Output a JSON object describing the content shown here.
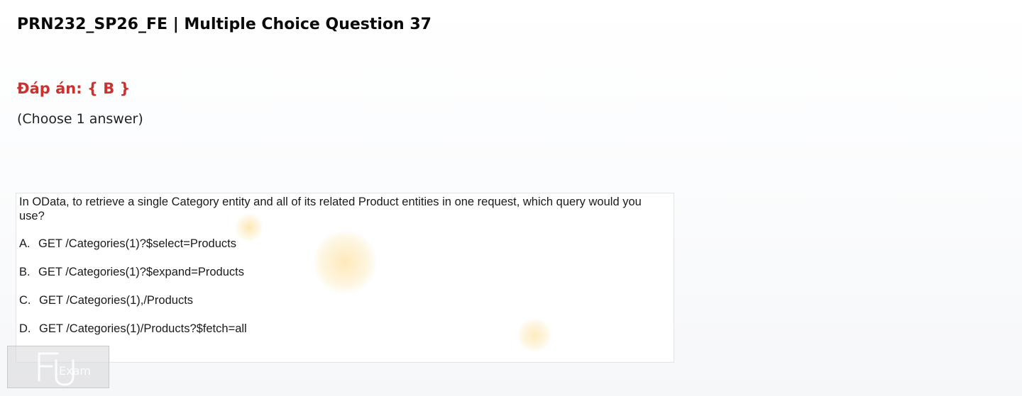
{
  "header": {
    "title": "PRN232_SP26_FE | Multiple Choice Question 37"
  },
  "answer": {
    "text": "Đáp án: { B }",
    "color": "#c8322f"
  },
  "instruction": {
    "text": "(Choose 1 answer)"
  },
  "question": {
    "text": "In OData, to retrieve a single Category entity and all of its related Product entities in one request, which query would you use?",
    "options": [
      {
        "letter": "A.",
        "text": "GET /Categories(1)?$select=Products"
      },
      {
        "letter": "B.",
        "text": "GET /Categories(1)?$expand=Products"
      },
      {
        "letter": "C.",
        "text": "GET /Categories(1),/Products"
      },
      {
        "letter": "D.",
        "text": "GET /Categories(1)/Products?$fetch=all"
      }
    ]
  },
  "watermark": {
    "text": "FU Exam",
    "icon": "fu-exam-logo"
  }
}
